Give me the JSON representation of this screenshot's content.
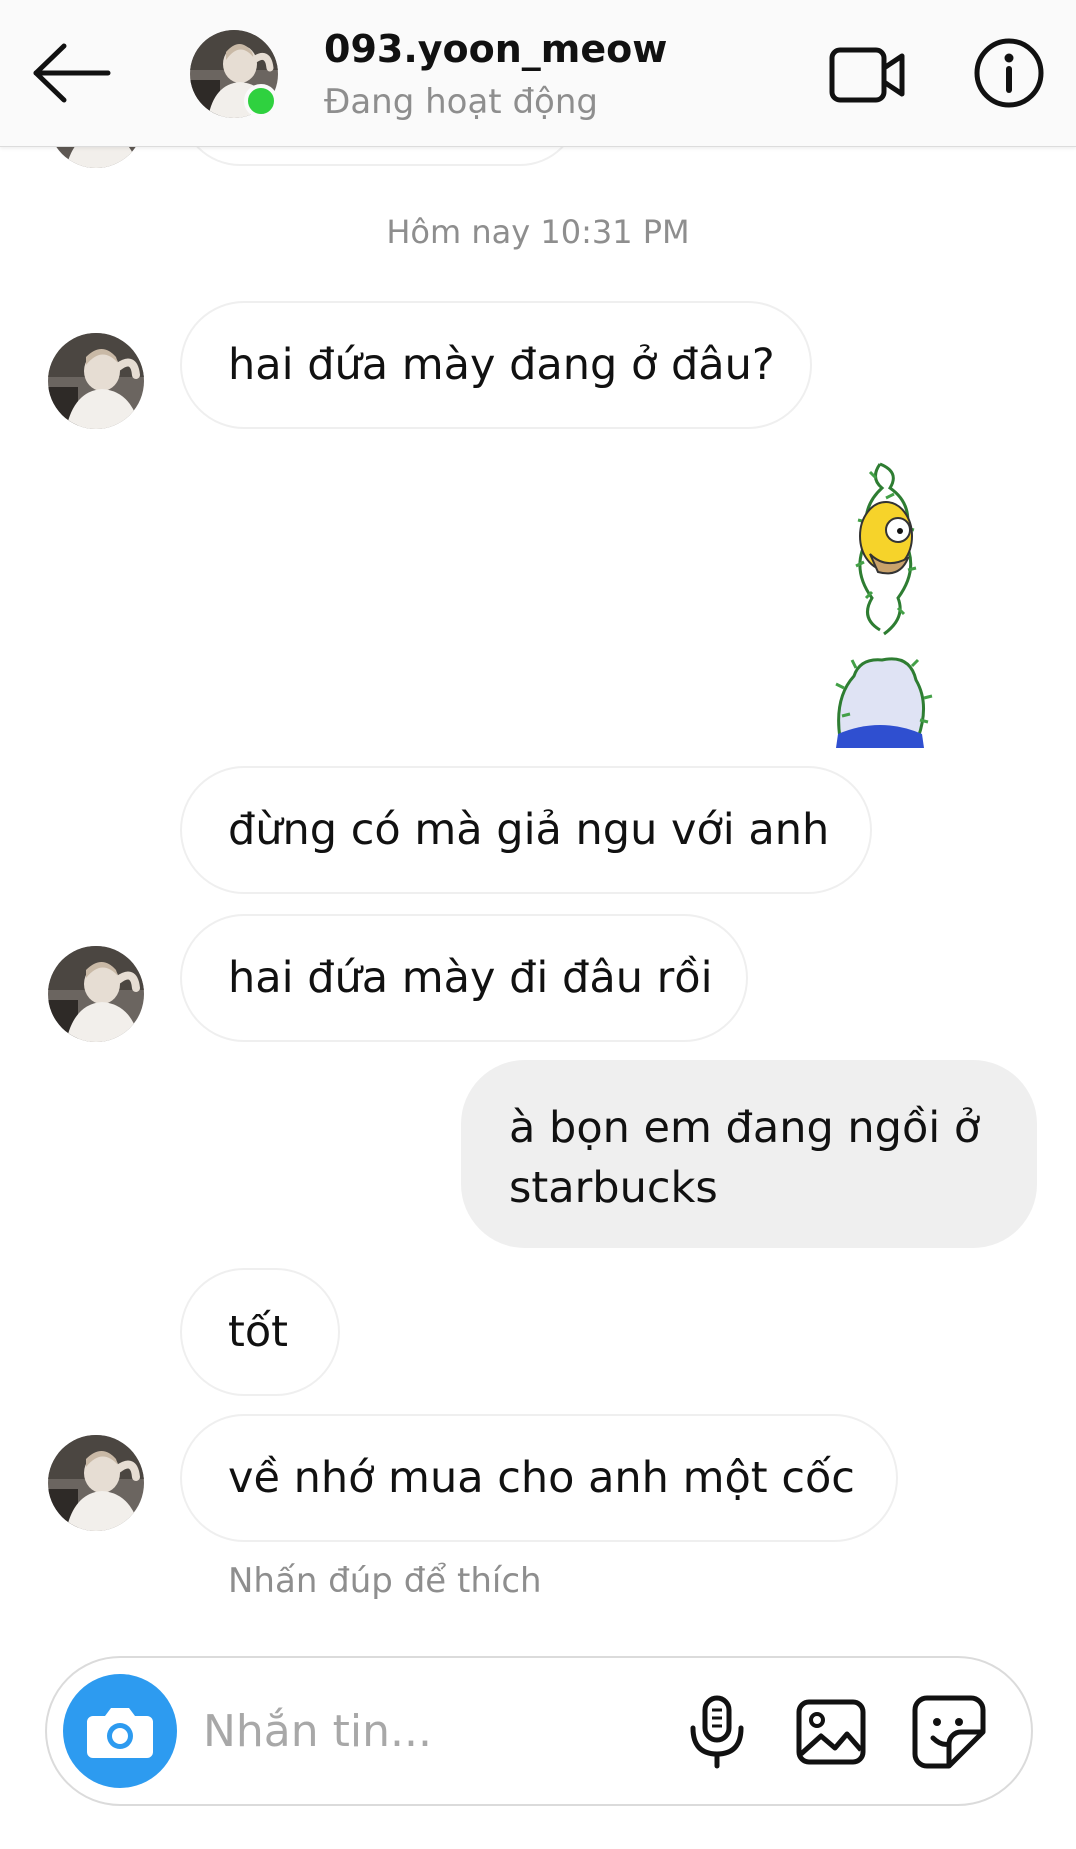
{
  "header": {
    "username": "093.yoon_meow",
    "status": "Đang hoạt động",
    "online_color": "#2fd13f",
    "icons": {
      "back": "arrow-left-icon",
      "video": "video-camera-icon",
      "info": "info-icon"
    }
  },
  "conversation": {
    "timestamp": "Hôm nay 10:31 PM",
    "messages": [
      {
        "direction": "incoming",
        "text": "hai đứa mày đang ở đâu?"
      },
      {
        "direction": "outgoing",
        "type": "sticker",
        "sticker": "homer-bushes-sticker"
      },
      {
        "direction": "incoming",
        "text": "đừng có mà giả ngu với anh"
      },
      {
        "direction": "incoming",
        "text": "hai đứa mày đi đâu rồi"
      },
      {
        "direction": "outgoing",
        "text": "à bọn em đang ngồi ở starbucks"
      },
      {
        "direction": "incoming",
        "text": "tốt"
      },
      {
        "direction": "incoming",
        "text": "về nhớ mua cho anh một cốc"
      }
    ],
    "hint": "Nhấn đúp để thích"
  },
  "composer": {
    "placeholder": "Nhắn tin...",
    "value": "",
    "camera_color": "#2d9bf0",
    "icons": {
      "camera": "camera-icon",
      "mic": "microphone-icon",
      "photo": "image-icon",
      "sticker": "sticker-icon"
    }
  }
}
